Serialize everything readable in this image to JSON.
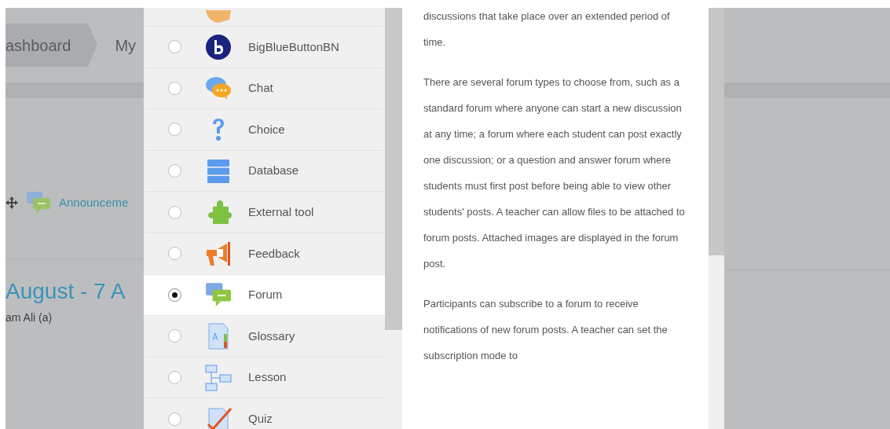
{
  "breadcrumb": [
    {
      "label": "ashboard"
    },
    {
      "label": "My"
    }
  ],
  "course": {
    "activity_link": "Announceme",
    "section_title": "August - 7 A",
    "section_note": "am Ali (a)"
  },
  "chooser": {
    "modules": [
      {
        "kind": "partial"
      },
      {
        "label": "BigBlueButtonBN",
        "selected": false
      },
      {
        "label": "Chat",
        "selected": false
      },
      {
        "label": "Choice",
        "selected": false
      },
      {
        "label": "Database",
        "selected": false
      },
      {
        "label": "External tool",
        "selected": false
      },
      {
        "label": "Feedback",
        "selected": false
      },
      {
        "label": "Forum",
        "selected": true
      },
      {
        "label": "Glossary",
        "selected": false
      },
      {
        "label": "Lesson",
        "selected": false
      },
      {
        "label": "Quiz",
        "selected": false
      }
    ],
    "description": [
      "discussions that take place over an extended period of time.",
      "There are several forum types to choose from, such as a standard forum where anyone can start a new discussion at any time; a forum where each student can post exactly one discussion; or a question and answer forum where students must first post before being able to view other students' posts. A teacher can allow files to be attached to forum posts. Attached images are displayed in the forum post.",
      "Participants can subscribe to a forum to receive notifications of new forum posts. A teacher can set the subscription mode to"
    ]
  }
}
